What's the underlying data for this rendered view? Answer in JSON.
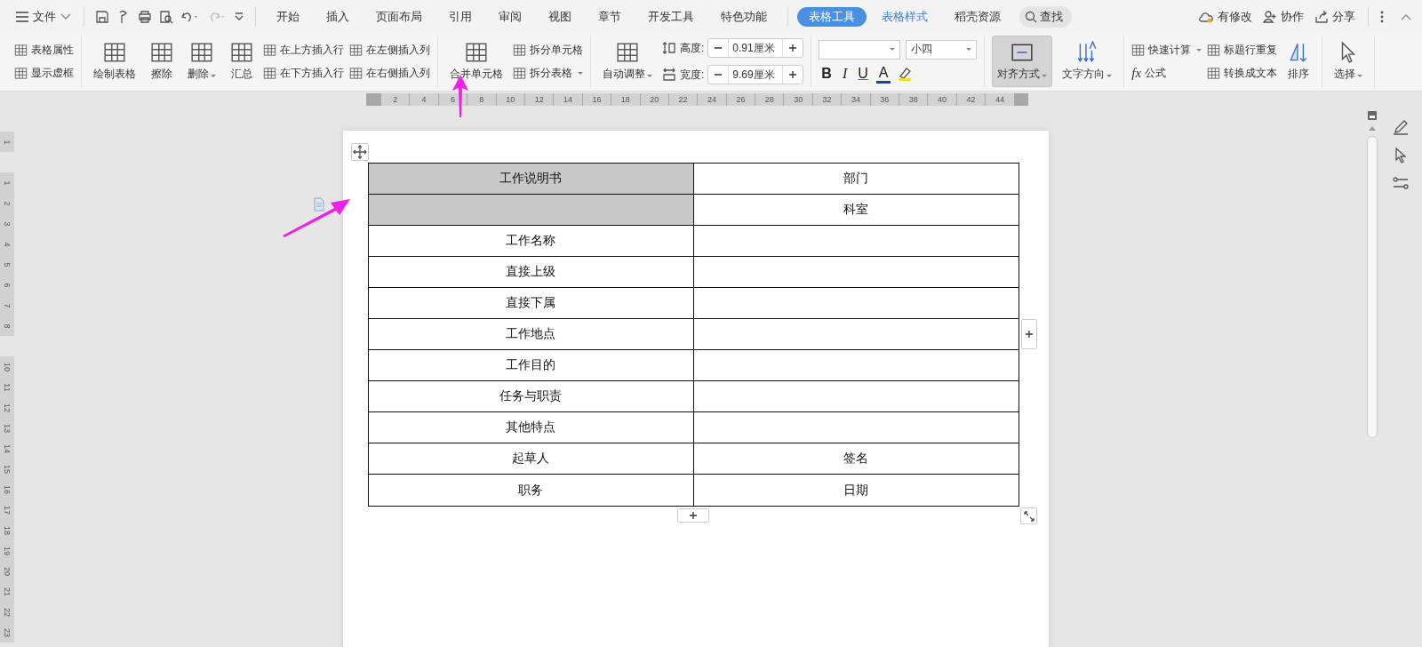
{
  "menu": {
    "file": "文件",
    "tabs": [
      {
        "label": "开始",
        "selected": false,
        "contextual": false
      },
      {
        "label": "插入",
        "selected": false,
        "contextual": false
      },
      {
        "label": "页面布局",
        "selected": false,
        "contextual": false
      },
      {
        "label": "引用",
        "selected": false,
        "contextual": false
      },
      {
        "label": "审阅",
        "selected": false,
        "contextual": false
      },
      {
        "label": "视图",
        "selected": false,
        "contextual": false
      },
      {
        "label": "章节",
        "selected": false,
        "contextual": false
      },
      {
        "label": "开发工具",
        "selected": false,
        "contextual": false
      },
      {
        "label": "特色功能",
        "selected": false,
        "contextual": false
      },
      {
        "label": "表格工具",
        "selected": true,
        "contextual": true
      },
      {
        "label": "表格样式",
        "selected": false,
        "contextual": true
      },
      {
        "label": "稻壳资源",
        "selected": false,
        "contextual": false
      }
    ],
    "search": "查找",
    "actions": [
      "有修改",
      "协作",
      "分享"
    ]
  },
  "ribbon": {
    "groups": [
      {
        "columns": [
          {
            "kind": "stack",
            "items": [
              {
                "label": "表格属性",
                "dropdown": false
              },
              {
                "label": "显示虚框",
                "dropdown": false
              }
            ]
          }
        ]
      },
      {
        "columns": [
          {
            "kind": "large",
            "label": "绘制表格",
            "dropdown": false,
            "pressed": false
          },
          {
            "kind": "large",
            "label": "擦除",
            "dropdown": false,
            "pressed": false
          },
          {
            "kind": "large",
            "label": "删除",
            "dropdown": true,
            "pressed": false
          },
          {
            "kind": "large",
            "label": "汇总",
            "dropdown": false,
            "pressed": false
          },
          {
            "kind": "stack",
            "items": [
              {
                "label": "在上方插入行",
                "dropdown": false
              },
              {
                "label": "在下方插入行",
                "dropdown": false
              }
            ]
          },
          {
            "kind": "stack",
            "items": [
              {
                "label": "在左侧插入列",
                "dropdown": false
              },
              {
                "label": "在右侧插入列",
                "dropdown": false
              }
            ]
          }
        ]
      },
      {
        "columns": [
          {
            "kind": "large",
            "label": "合并单元格",
            "dropdown": false,
            "pressed": false
          },
          {
            "kind": "stack",
            "items": [
              {
                "label": "拆分单元格",
                "dropdown": false
              },
              {
                "label": "拆分表格",
                "dropdown": true
              }
            ]
          }
        ]
      },
      {
        "columns": [
          {
            "kind": "large",
            "label": "自动调整",
            "dropdown": true,
            "pressed": false
          },
          {
            "kind": "spinners",
            "items": [
              {
                "label": "高度:",
                "value": "0.91厘米"
              },
              {
                "label": "宽度:",
                "value": "9.69厘米"
              }
            ]
          }
        ]
      },
      {
        "columns": [
          {
            "kind": "font",
            "size": "小四",
            "buttons": [
              "B",
              "I",
              "U",
              "A"
            ]
          }
        ]
      },
      {
        "columns": [
          {
            "kind": "large",
            "label": "对齐方式",
            "dropdown": true,
            "pressed": true
          },
          {
            "kind": "large",
            "label": "文字方向",
            "dropdown": true,
            "pressed": false
          }
        ]
      },
      {
        "columns": [
          {
            "kind": "stack",
            "items": [
              {
                "label": "快速计算",
                "dropdown": true
              },
              {
                "label": "公式",
                "dropdown": false,
                "glyph": "fx"
              }
            ]
          },
          {
            "kind": "stack",
            "items": [
              {
                "label": "标题行重复",
                "dropdown": false
              },
              {
                "label": "转换成文本",
                "dropdown": false
              }
            ]
          },
          {
            "kind": "large",
            "label": "排序",
            "dropdown": false,
            "pressed": false
          }
        ]
      },
      {
        "columns": [
          {
            "kind": "large",
            "label": "选择",
            "dropdown": true,
            "pressed": false
          }
        ]
      }
    ]
  },
  "ruler": {
    "horizontal": [
      "2",
      "4",
      "6",
      "8",
      "10",
      "12",
      "14",
      "16",
      "18",
      "20",
      "22",
      "24",
      "26",
      "28",
      "30",
      "32",
      "34",
      "36",
      "38",
      "40",
      "42",
      "44"
    ],
    "vertical": [
      "1",
      "1",
      "2",
      "3",
      "4",
      "5",
      "6",
      "7",
      "8",
      "10",
      "11",
      "12",
      "13",
      "14",
      "15",
      "16",
      "17",
      "18",
      "19",
      "20",
      "21",
      "22",
      "23"
    ]
  },
  "table": {
    "rows": [
      {
        "cells": [
          {
            "text": "工作说明书",
            "selected": true
          },
          {
            "text": "部门",
            "selected": false
          }
        ]
      },
      {
        "cells": [
          {
            "selected": true
          },
          {
            "text": "科室",
            "selected": false
          }
        ]
      },
      {
        "cells": [
          {
            "text": "工作名称",
            "selected": false
          },
          {
            "selected": false
          }
        ]
      },
      {
        "cells": [
          {
            "text": "直接上级",
            "selected": false
          },
          {
            "selected": false
          }
        ]
      },
      {
        "cells": [
          {
            "text": "直接下属",
            "selected": false
          },
          {
            "selected": false
          }
        ]
      },
      {
        "cells": [
          {
            "text": "工作地点",
            "selected": false
          },
          {
            "selected": false
          }
        ]
      },
      {
        "cells": [
          {
            "text": "工作目的",
            "selected": false
          },
          {
            "selected": false
          }
        ]
      },
      {
        "cells": [
          {
            "text": "任务与职责",
            "selected": false
          },
          {
            "selected": false
          }
        ]
      },
      {
        "cells": [
          {
            "text": "其他特点",
            "selected": false
          },
          {
            "selected": false
          }
        ]
      },
      {
        "cells": [
          {
            "text": "起草人",
            "selected": false
          },
          {
            "text": "签名",
            "selected": false
          }
        ]
      },
      {
        "cells": [
          {
            "text": "职务",
            "selected": false
          },
          {
            "text": "日期",
            "selected": false
          }
        ]
      }
    ]
  }
}
